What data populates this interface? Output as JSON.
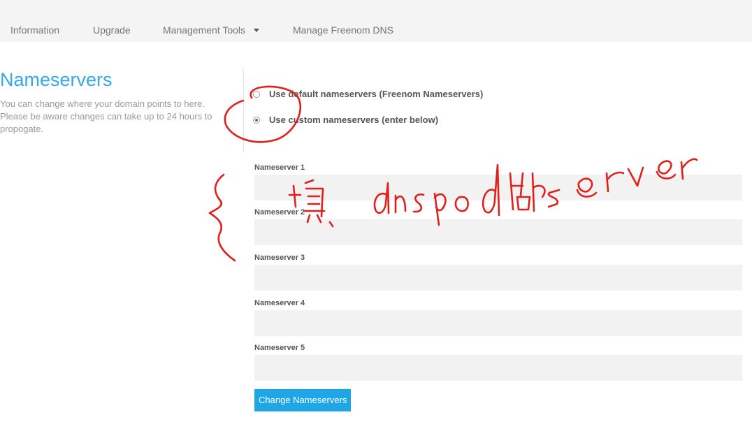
{
  "nav": {
    "items": [
      {
        "label": "Information"
      },
      {
        "label": "Upgrade"
      },
      {
        "label": "Management Tools"
      },
      {
        "label": "Manage Freenom DNS"
      }
    ]
  },
  "section": {
    "title": "Nameservers",
    "description": "You can change where your domain points to here. Please be aware changes can take up to 24 hours to propogate."
  },
  "options": [
    {
      "label": "Use default nameservers (Freenom Nameservers)",
      "checked": false
    },
    {
      "label": "Use custom nameservers (enter below)",
      "checked": true
    }
  ],
  "fields": [
    {
      "label": "Nameserver 1",
      "value": ""
    },
    {
      "label": "Nameserver 2",
      "value": ""
    },
    {
      "label": "Nameserver 3",
      "value": ""
    },
    {
      "label": "Nameserver 4",
      "value": ""
    },
    {
      "label": "Nameserver 5",
      "value": ""
    }
  ],
  "submit_label": "Change Nameservers",
  "annotation": {
    "handwriting": "填 dnspod 的 server",
    "color": "#e0201c"
  },
  "colors": {
    "title": "#33a9e6",
    "button": "#1fa6e6",
    "nav_bg": "#f4f4f4",
    "input_bg": "#f2f2f2"
  }
}
